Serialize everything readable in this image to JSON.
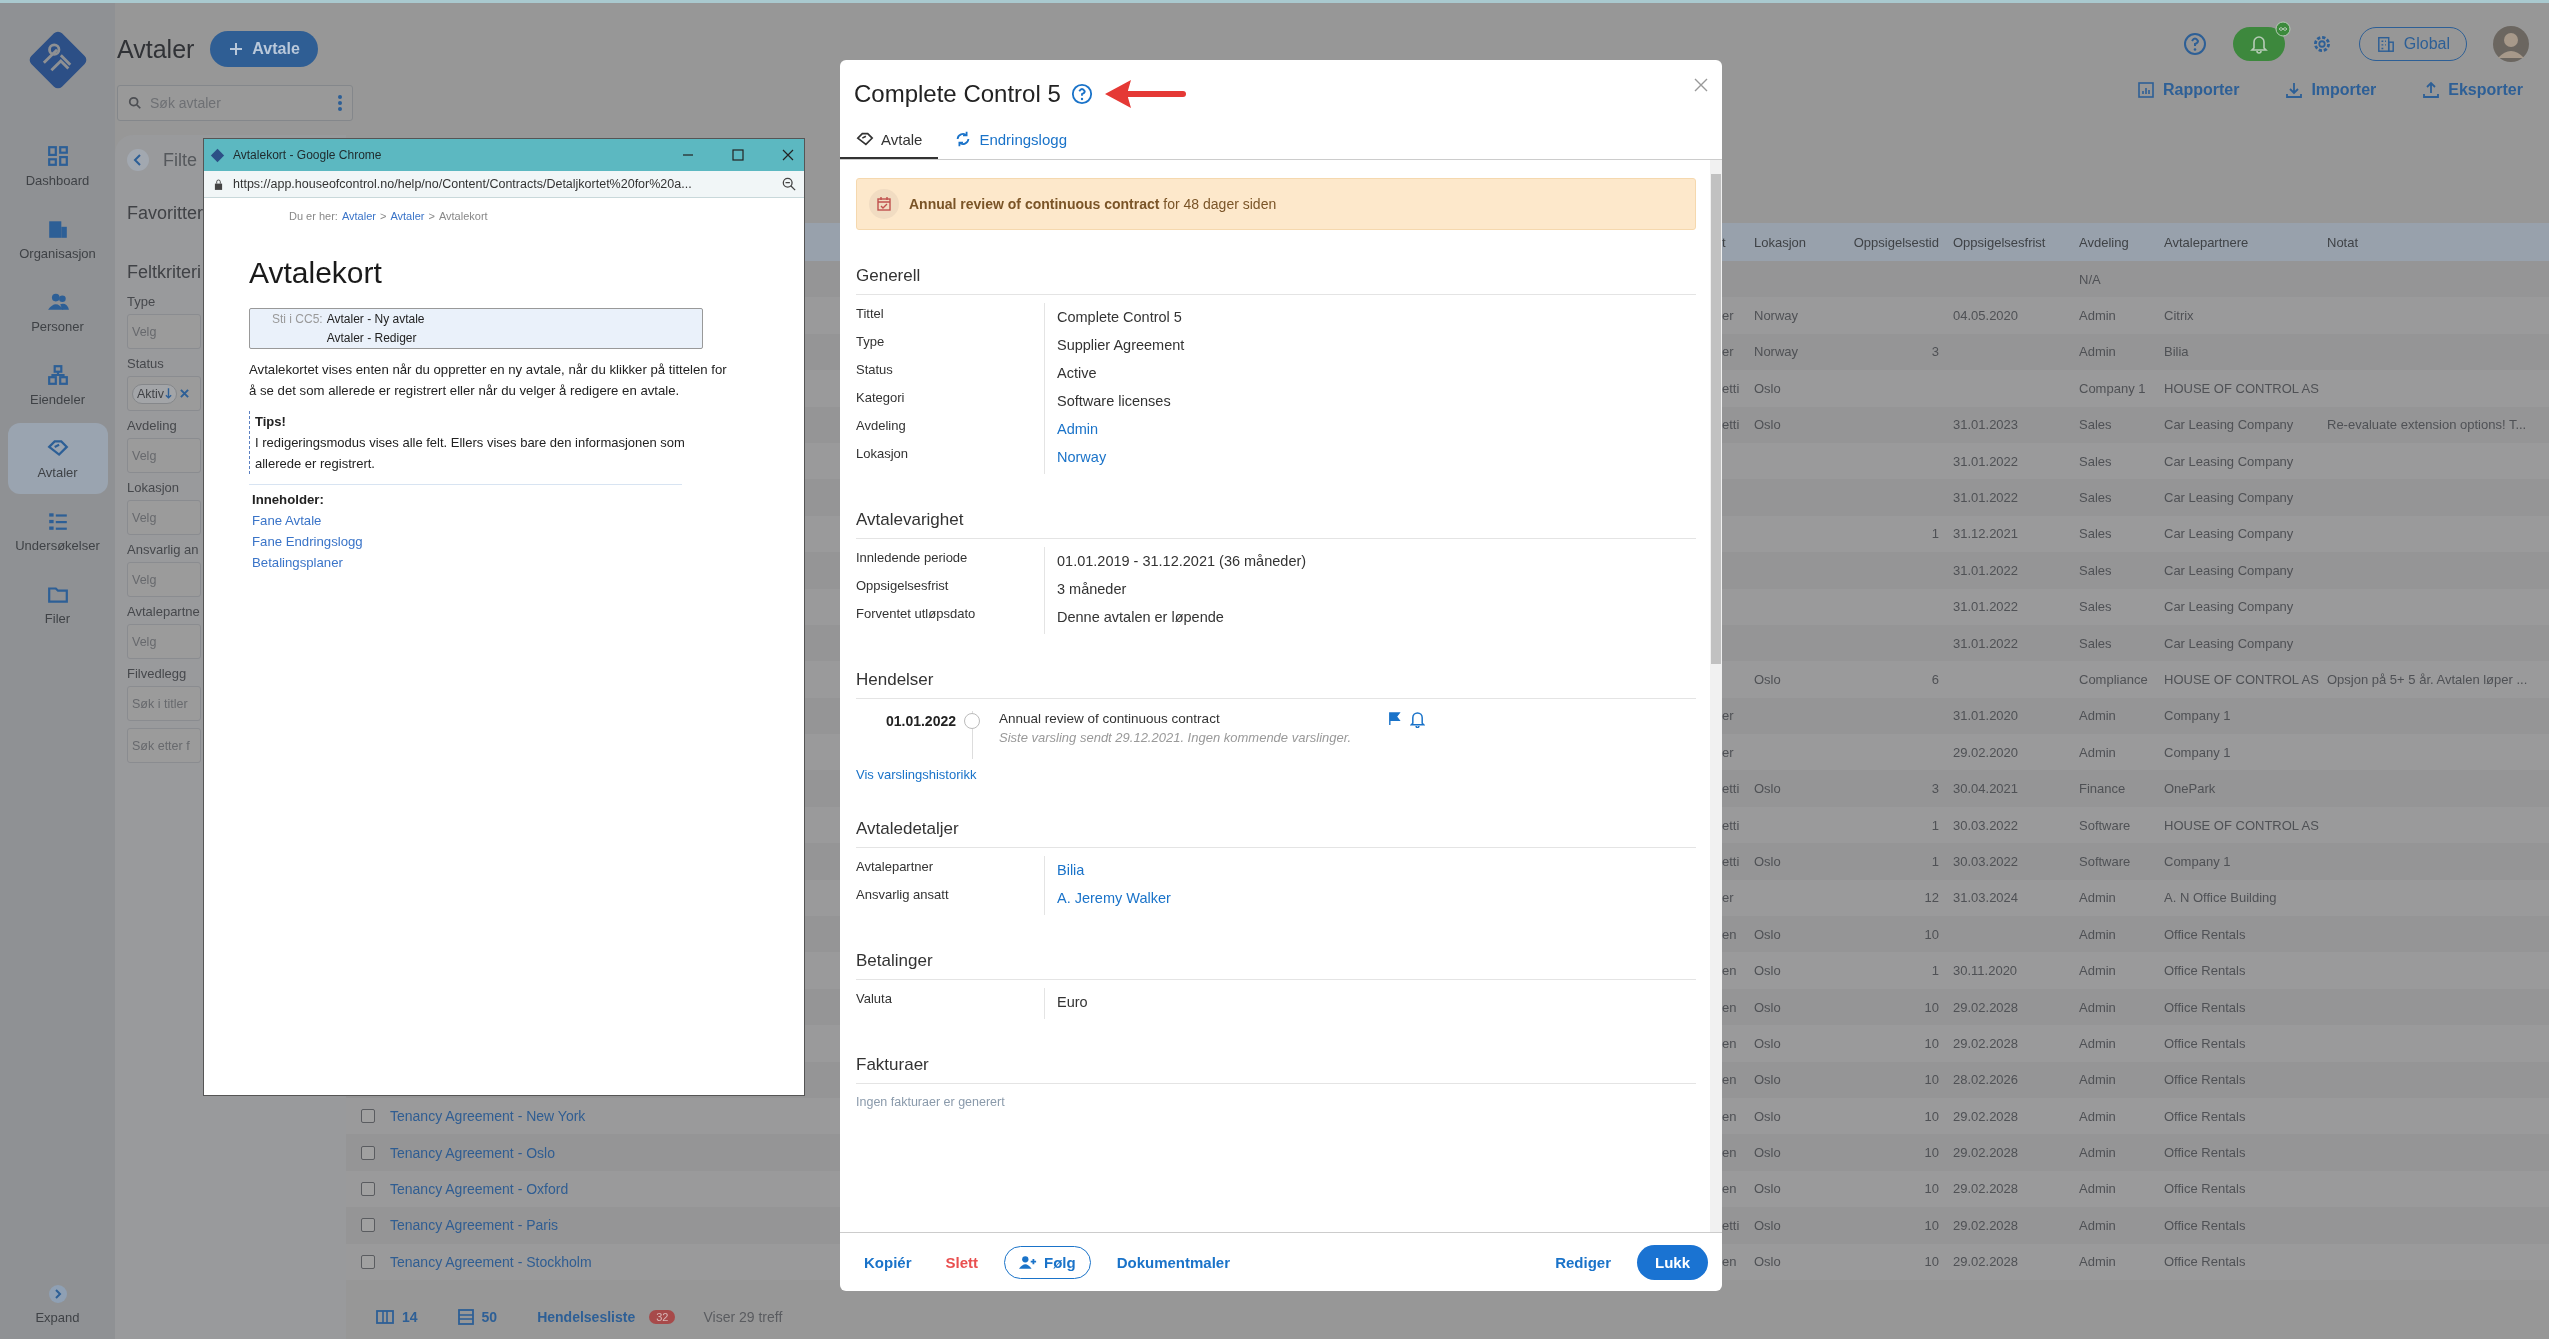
{
  "sidebar": {
    "items": [
      {
        "label": "Dashboard",
        "selected": false
      },
      {
        "label": "Organisasjon",
        "selected": false
      },
      {
        "label": "Personer",
        "selected": false
      },
      {
        "label": "Eiendeler",
        "selected": false
      },
      {
        "label": "Avtaler",
        "selected": true
      },
      {
        "label": "Undersøkelser",
        "selected": false
      },
      {
        "label": "Filer",
        "selected": false
      }
    ],
    "expand": "Expand"
  },
  "header": {
    "title": "Avtaler",
    "new_button": "Avtale",
    "search": {
      "placeholder": "Søk avtaler"
    },
    "scope_button": "Global",
    "actions": [
      "Rapporter",
      "Importer",
      "Eksporter"
    ]
  },
  "filter_panel": {
    "title": "Filte",
    "favorites": "Favoritter",
    "criteria": "Feltkriteri",
    "fields": [
      {
        "label": "Type",
        "kind": "select",
        "placeholder": "Velg"
      },
      {
        "label": "Status",
        "kind": "chips",
        "chip": "Aktiv"
      },
      {
        "label": "Avdeling",
        "kind": "select",
        "placeholder": "Velg"
      },
      {
        "label": "Lokasjon",
        "kind": "select",
        "placeholder": "Velg"
      },
      {
        "label": "Ansvarlig an",
        "kind": "select",
        "placeholder": "Velg"
      },
      {
        "label": "Avtalepartne",
        "kind": "select",
        "placeholder": "Velg"
      },
      {
        "label": "Filvedlegg",
        "kind": "text",
        "placeholder": "Søk i titler"
      },
      {
        "kind": "text",
        "placeholder": "Søk etter f"
      }
    ]
  },
  "table": {
    "columns": [
      "t",
      "Lokasjon",
      "Oppsigelsestid",
      "Oppsigelsesfrist",
      "Avdeling",
      "Avtalepartnere",
      "Notat"
    ],
    "rows": [
      {
        "avdeling": "N/A"
      },
      {
        "column_1": "er",
        "lokasjon": "Norway",
        "oppsigelsesfrist": "04.05.2020",
        "avdeling": "Admin",
        "avtalepartnere": "Citrix"
      },
      {
        "column_1": "er",
        "lokasjon": "Norway",
        "oppsigelsestid": "3",
        "avdeling": "Admin",
        "avtalepartnere": "Bilia"
      },
      {
        "column_1": "etti",
        "lokasjon": "Oslo",
        "avdeling": "Company 1",
        "avtalepartnere": "HOUSE OF CONTROL AS"
      },
      {
        "column_1": "etti",
        "lokasjon": "Oslo",
        "oppsigelsesfrist": "31.01.2023",
        "avdeling": "Sales",
        "avtalepartnere": "Car Leasing Company",
        "notat": "Re-evaluate extension options! T..."
      },
      {
        "oppsigelsesfrist": "31.01.2022",
        "avdeling": "Sales",
        "avtalepartnere": "Car Leasing Company"
      },
      {
        "oppsigelsesfrist": "31.01.2022",
        "avdeling": "Sales",
        "avtalepartnere": "Car Leasing Company"
      },
      {
        "oppsigelsestid": "1",
        "oppsigelsesfrist": "31.12.2021",
        "avdeling": "Sales",
        "avtalepartnere": "Car Leasing Company"
      },
      {
        "oppsigelsesfrist": "31.01.2022",
        "avdeling": "Sales",
        "avtalepartnere": "Car Leasing Company"
      },
      {
        "oppsigelsesfrist": "31.01.2022",
        "avdeling": "Sales",
        "avtalepartnere": "Car Leasing Company"
      },
      {
        "oppsigelsesfrist": "31.01.2022",
        "avdeling": "Sales",
        "avtalepartnere": "Car Leasing Company"
      },
      {
        "lokasjon": "Oslo",
        "oppsigelsestid": "6",
        "avdeling": "Compliance",
        "avtalepartnere": "HOUSE OF CONTROL AS",
        "notat": "Opsjon på 5+ 5 år. Avtalen løper ..."
      },
      {
        "column_1": "er",
        "oppsigelsesfrist": "31.01.2020",
        "avdeling": "Admin",
        "avtalepartnere": "Company 1"
      },
      {
        "column_1": "er",
        "oppsigelsesfrist": "29.02.2020",
        "avdeling": "Admin",
        "avtalepartnere": "Company 1"
      },
      {
        "column_1": "etti",
        "lokasjon": "Oslo",
        "oppsigelsestid": "3",
        "oppsigelsesfrist": "30.04.2021",
        "avdeling": "Finance",
        "avtalepartnere": "OnePark"
      },
      {
        "column_1": "etti",
        "oppsigelsestid": "1",
        "oppsigelsesfrist": "30.03.2022",
        "avdeling": "Software",
        "avtalepartnere": "HOUSE OF CONTROL AS"
      },
      {
        "column_1": "etti",
        "lokasjon": "Oslo",
        "oppsigelsestid": "1",
        "oppsigelsesfrist": "30.03.2022",
        "avdeling": "Software",
        "avtalepartnere": "Company 1"
      },
      {
        "column_1": "er",
        "oppsigelsestid": "12",
        "oppsigelsesfrist": "31.03.2024",
        "avdeling": "Admin",
        "avtalepartnere": "A. N Office Building"
      },
      {
        "column_1": "en",
        "lokasjon": "Oslo",
        "oppsigelsestid": "10",
        "avdeling": "Admin",
        "avtalepartnere": "Office Rentals"
      },
      {
        "column_1": "en",
        "lokasjon": "Oslo",
        "oppsigelsestid": "1",
        "oppsigelsesfrist": "30.11.2020",
        "avdeling": "Admin",
        "avtalepartnere": "Office Rentals"
      },
      {
        "column_1": "en",
        "lokasjon": "Oslo",
        "oppsigelsestid": "10",
        "oppsigelsesfrist": "29.02.2028",
        "avdeling": "Admin",
        "avtalepartnere": "Office Rentals"
      },
      {
        "column_1": "en",
        "lokasjon": "Oslo",
        "oppsigelsestid": "10",
        "oppsigelsesfrist": "29.02.2028",
        "avdeling": "Admin",
        "avtalepartnere": "Office Rentals"
      },
      {
        "column_1": "en",
        "lokasjon": "Oslo",
        "oppsigelsestid": "10",
        "oppsigelsesfrist": "28.02.2026",
        "avdeling": "Admin",
        "avtalepartnere": "Office Rentals"
      },
      {
        "title": "Tenancy Agreement - New York",
        "checked": false,
        "column_1": "en",
        "lokasjon": "Oslo",
        "oppsigelsestid": "10",
        "oppsigelsesfrist": "29.02.2028",
        "avdeling": "Admin",
        "avtalepartnere": "Office Rentals"
      },
      {
        "title": "Tenancy Agreement - Oslo",
        "checked": false,
        "column_1": "en",
        "lokasjon": "Oslo",
        "oppsigelsestid": "10",
        "oppsigelsesfrist": "29.02.2028",
        "avdeling": "Admin",
        "avtalepartnere": "Office Rentals"
      },
      {
        "title": "Tenancy Agreement - Oxford",
        "checked": false,
        "column_1": "en",
        "lokasjon": "Oslo",
        "oppsigelsestid": "10",
        "oppsigelsesfrist": "29.02.2028",
        "avdeling": "Admin",
        "avtalepartnere": "Office Rentals"
      },
      {
        "title": "Tenancy Agreement - Paris",
        "checked": false,
        "column_1": "etti",
        "lokasjon": "Oslo",
        "oppsigelsestid": "10",
        "oppsigelsesfrist": "29.02.2028",
        "avdeling": "Admin",
        "avtalepartnere": "Office Rentals"
      },
      {
        "title": "Tenancy Agreement - Stockholm",
        "checked": false,
        "column_1": "en",
        "lokasjon": "Oslo",
        "oppsigelsestid": "10",
        "oppsigelsesfrist": "29.02.2028",
        "avdeling": "Admin",
        "avtalepartnere": "Office Rentals"
      }
    ]
  },
  "footer": {
    "columns_count": "14",
    "page_size": "50",
    "events_label": "Hendelsesliste",
    "events_count": "32",
    "result_text": "Viser 29 treff"
  },
  "help_window": {
    "title": "Avtalekort - Google Chrome",
    "url": "https://app.houseofcontrol.no/help/no/Content/Contracts/Detaljkortet%20for%20a...",
    "breadcrumb": {
      "prefix": "Du er her:",
      "links": [
        "Avtaler",
        "Avtaler"
      ],
      "separator": ">",
      "current": "Avtalekort"
    },
    "heading": "Avtalekort",
    "path": {
      "label": "Sti i CC5:",
      "items": [
        "Avtaler - Ny avtale",
        "Avtaler - Rediger"
      ]
    },
    "paragraph": "Avtalekortet vises enten når du oppretter en ny avtale, når du klikker på tittelen for å se det som allerede er registrert eller når du velger å redigere en avtale.",
    "tip": {
      "title": "Tips!",
      "text": "I redigeringsmodus vises alle felt. Ellers vises bare den informasjonen som allerede er registrert."
    },
    "contents": {
      "title": "Inneholder:",
      "links": [
        "Fane Avtale",
        "Fane Endringslogg",
        "Betalingsplaner"
      ]
    }
  },
  "modal": {
    "title": "Complete Control 5",
    "tabs": [
      {
        "label": "Avtale",
        "selected": true
      },
      {
        "label": "Endringslogg",
        "selected": false
      }
    ],
    "alert": "**Annual review of continuous contract** for 48 dager siden",
    "sections": [
      {
        "title": "Generell",
        "kind": "fields",
        "fields": [
          {
            "label": "Tittel",
            "value": "Complete Control 5",
            "link": false
          },
          {
            "label": "Type",
            "value": "Supplier Agreement",
            "link": false
          },
          {
            "label": "Status",
            "value": "Active",
            "link": false
          },
          {
            "label": "Kategori",
            "value": "Software licenses",
            "link": false
          },
          {
            "label": "Avdeling",
            "value": "Admin",
            "link": true
          },
          {
            "label": "Lokasjon",
            "value": "Norway",
            "link": true
          }
        ]
      },
      {
        "title": "Avtalevarighet",
        "kind": "fields",
        "fields": [
          {
            "label": "Innledende periode",
            "value": "01.01.2019 - 31.12.2021 (36 måneder)",
            "link": false
          },
          {
            "label": "Oppsigelsesfrist",
            "value": "3 måneder",
            "link": false
          },
          {
            "label": "Forventet utløpsdato",
            "value": "Denne avtalen er løpende",
            "link": false
          }
        ]
      },
      {
        "title": "Hendelser",
        "kind": "events",
        "events": [
          {
            "date": "01.01.2022",
            "title": "Annual review of continuous contract",
            "note": "Siste varsling sendt 29.12.2021. Ingen kommende varslinger."
          }
        ],
        "link": "Vis varslingshistorikk"
      },
      {
        "title": "Avtaledetaljer",
        "kind": "fields",
        "fields": [
          {
            "label": "Avtalepartner",
            "value": "Bilia",
            "link": true
          },
          {
            "label": "Ansvarlig ansatt",
            "value": "A. Jeremy Walker",
            "link": true
          }
        ]
      },
      {
        "title": "Betalinger",
        "kind": "fields",
        "fields": [
          {
            "label": "Valuta",
            "value": "Euro",
            "link": false
          }
        ]
      },
      {
        "title": "Fakturaer",
        "kind": "empty",
        "text": "Ingen fakturaer er generert"
      }
    ],
    "footer_left": [
      {
        "label": "Kopiér",
        "kind": "link"
      },
      {
        "label": "Slett",
        "kind": "danger"
      },
      {
        "label": "Følg",
        "kind": "outline"
      },
      {
        "label": "Dokumentmaler",
        "kind": "link"
      }
    ],
    "footer_right": [
      {
        "label": "Rediger",
        "kind": "link"
      },
      {
        "label": "Lukk",
        "kind": "primary"
      }
    ]
  }
}
